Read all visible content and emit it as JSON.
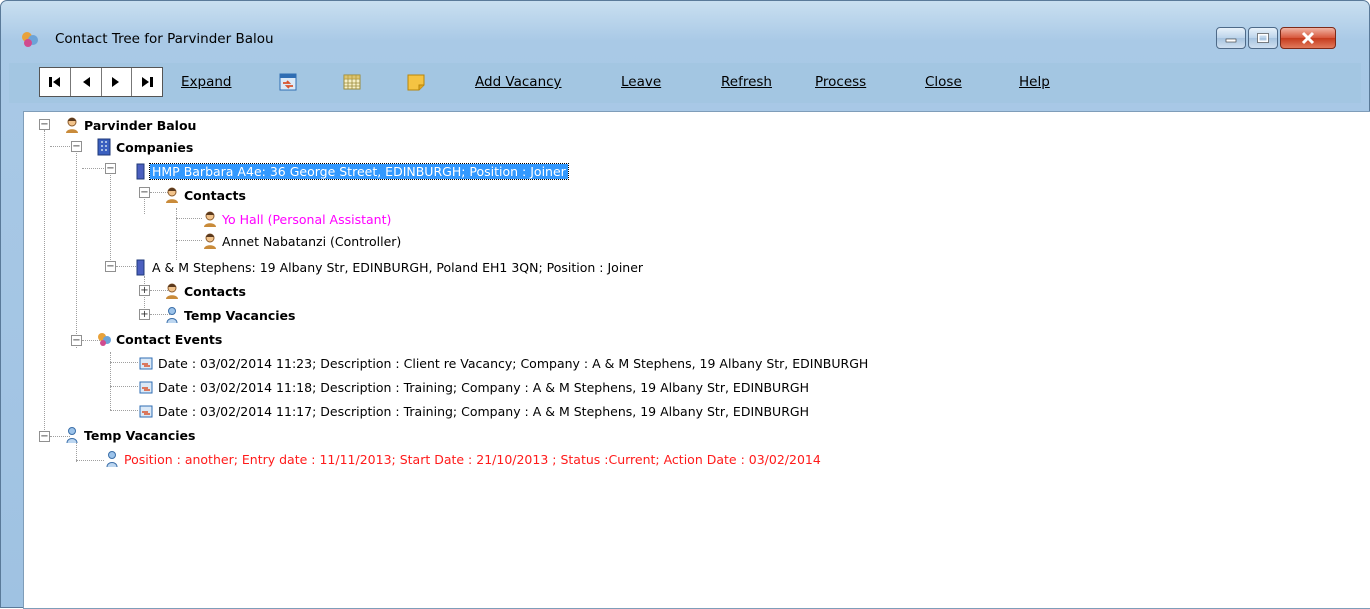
{
  "window": {
    "title": "Contact Tree for Parvinder Balou"
  },
  "toolbar": {
    "nav": [
      "|◀",
      "◀",
      "▶",
      "▶|"
    ],
    "expand": "Expand",
    "add_vacancy": "Add Vacancy",
    "leave": "Leave",
    "refresh": "Refresh",
    "process": "Process",
    "close": "Close",
    "help": "Help"
  },
  "tree": {
    "root": "Parvinder Balou",
    "companies": "Companies",
    "company1": "HMP Barbara A4e: 36 George Street, EDINBURGH; Position : Joiner",
    "company1_contacts": "Contacts",
    "contact1": "Yo Hall (Personal Assistant)",
    "contact2": "Annet Nabatanzi (Controller)",
    "company2": "A & M Stephens: 19 Albany Str, EDINBURGH, Poland EH1 3QN; Position : Joiner",
    "company2_contacts": "Contacts",
    "company2_temp": "Temp Vacancies",
    "contact_events": "Contact Events",
    "event1": "Date : 03/02/2014 11:23; Description : Client re Vacancy; Company : A & M Stephens, 19 Albany Str, EDINBURGH",
    "event2": "Date : 03/02/2014 11:18; Description : Training; Company : A & M Stephens, 19 Albany Str, EDINBURGH",
    "event3": "Date : 03/02/2014 11:17; Description : Training; Company : A & M Stephens, 19 Albany Str, EDINBURGH",
    "temp_vacancies": "Temp Vacancies",
    "vacancy1": "Position : another; Entry date : 11/11/2013; Start Date : 21/10/2013 ; Status :Current; Action Date : 03/02/2014"
  },
  "colors": {
    "selected": "#3399ff",
    "magenta": "#ff00ff",
    "red": "#ff1a1a"
  },
  "icons": [
    "app-icon",
    "person-icon",
    "building-icon",
    "calendar-swap-icon",
    "grid-icon",
    "note-icon",
    "event-icon",
    "vacancy-icon"
  ]
}
